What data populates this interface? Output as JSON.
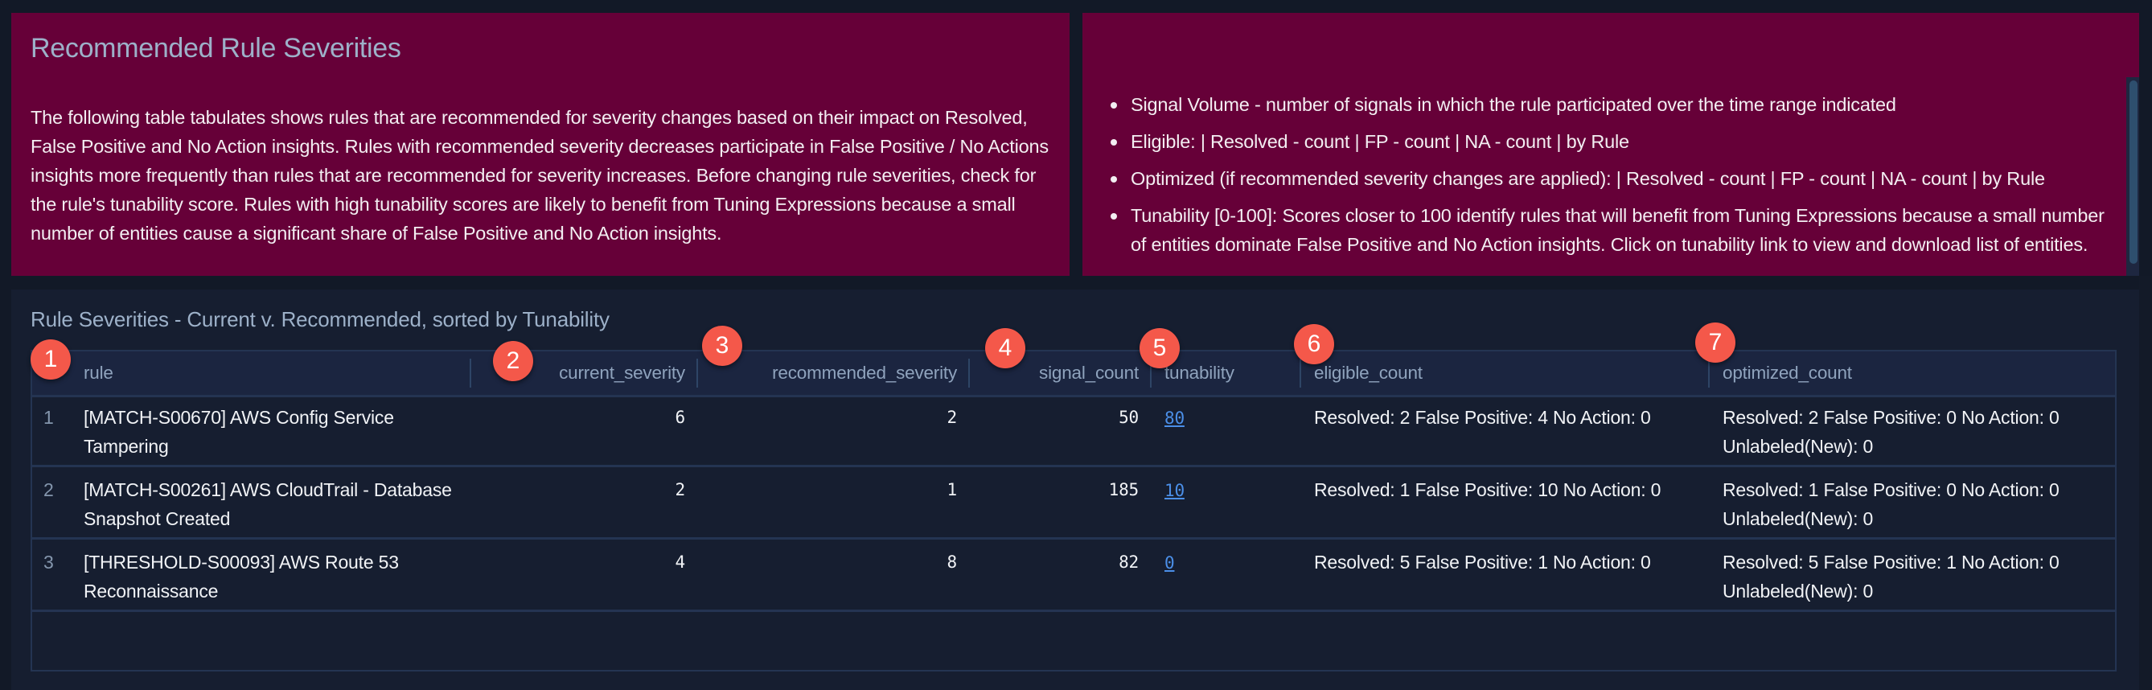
{
  "info_panel": {
    "title": "Recommended Rule Severities",
    "description": "The following table tabulates shows rules that are recommended for severity changes based on their impact on Resolved, False Positive and No Action insights. Rules with recommended severity decreases participate in False Positive / No Actions insights more frequently than rules that are recommended for severity increases. Before changing rule severities, check for the rule's tunability score. Rules with high tunability scores are likely to benefit from Tuning Expressions because a small number of entities cause a significant share of False Positive and No Action insights."
  },
  "legend_panel": {
    "bullets": [
      "Signal Volume - number of signals in which the rule participated over the time range indicated",
      "Eligible: | Resolved - count | FP - count | NA - count | by Rule",
      "Optimized (if recommended severity changes are applied): | Resolved - count | FP - count | NA - count | by Rule",
      "Tunability [0-100]: Scores closer to 100 identify rules that will benefit from Tuning Expressions because a small number of entities dominate False Positive and No Action insights. Click on tunability link to view and download list of entities."
    ]
  },
  "table": {
    "title": "Rule Severities - Current v. Recommended, sorted by Tunability",
    "columns": [
      "rule",
      "current_severity",
      "recommended_severity",
      "signal_count",
      "tunability",
      "eligible_count",
      "optimized_count"
    ],
    "badges": [
      "1",
      "2",
      "3",
      "4",
      "5",
      "6",
      "7"
    ],
    "rows": [
      {
        "index": "1",
        "rule": "[MATCH-S00670] AWS Config Service Tampering",
        "current_severity": "6",
        "recommended_severity": "2",
        "signal_count": "50",
        "tunability": "80",
        "eligible_count": "Resolved: 2 False Positive: 4 No Action: 0",
        "optimized_count": "Resolved: 2 False Positive: 0 No Action: 0 Unlabeled(New): 0"
      },
      {
        "index": "2",
        "rule": "[MATCH-S00261] AWS CloudTrail - Database Snapshot Created",
        "current_severity": "2",
        "recommended_severity": "1",
        "signal_count": "185",
        "tunability": "10",
        "eligible_count": "Resolved: 1 False Positive: 10 No Action: 0",
        "optimized_count": "Resolved: 1 False Positive: 0 No Action: 0 Unlabeled(New): 0"
      },
      {
        "index": "3",
        "rule": "[THRESHOLD-S00093] AWS Route 53 Reconnaissance",
        "current_severity": "4",
        "recommended_severity": "8",
        "signal_count": "82",
        "tunability": "0",
        "eligible_count": "Resolved: 5 False Positive: 1 No Action: 0",
        "optimized_count": "Resolved: 5 False Positive: 1 No Action: 0 Unlabeled(New): 0"
      }
    ]
  },
  "colors": {
    "panel_bg": "#660038",
    "page_bg": "#121927",
    "badge": "#f4584a",
    "link": "#4b8fe8"
  }
}
